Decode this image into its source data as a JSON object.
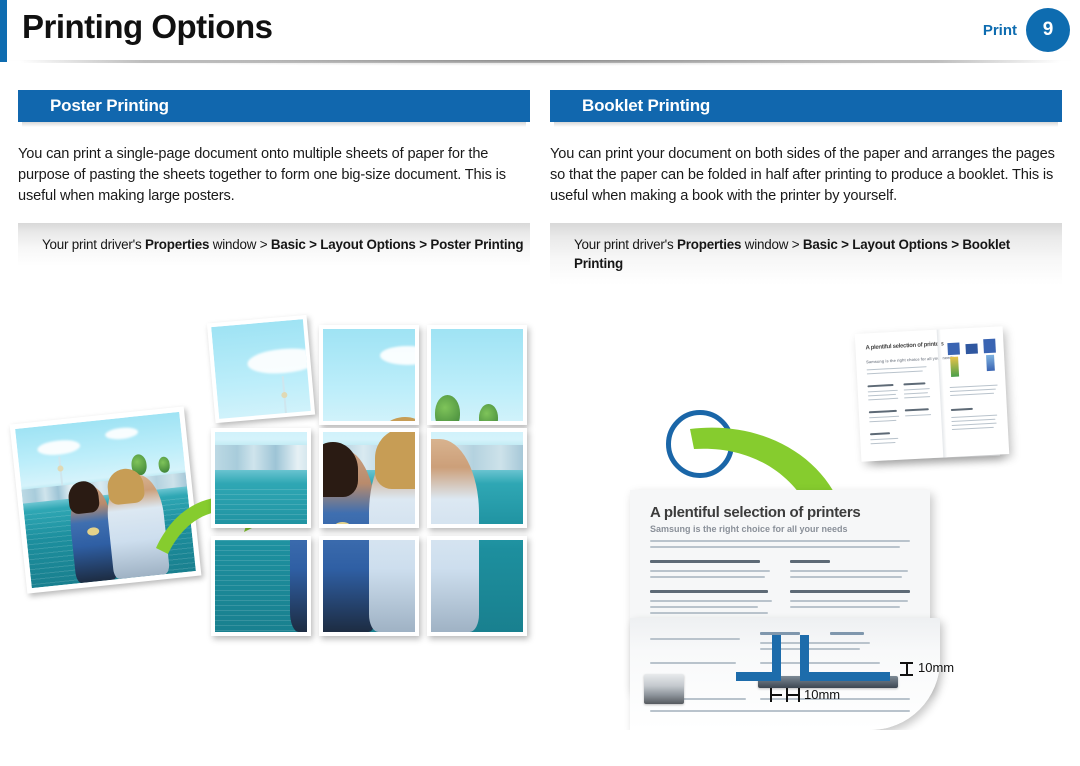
{
  "header": {
    "title": "Printing Options",
    "section_label": "Print",
    "page_number": "9",
    "accent_color": "#0e6cb0"
  },
  "columns": [
    {
      "id": "poster-printing",
      "heading": "Poster Printing",
      "body": "You can print a single-page document onto multiple sheets of paper for the purpose of pasting the sheets together to form one big-size document. This is useful when making large posters.",
      "path": {
        "prefix": "Your print driver's ",
        "bold1": "Properties",
        "mid": " window > ",
        "bold2": "Basic > Layout Options > Poster Printing"
      }
    },
    {
      "id": "booklet-printing",
      "heading": "Booklet Printing",
      "body": "You can print your document on both sides of the paper and arranges the pages so that the paper can be folded in half after printing to produce a booklet. This is useful when making a book with the printer by yourself.",
      "path": {
        "prefix": "Your print driver's ",
        "bold1": "Properties",
        "mid": " window > ",
        "bold2": "Basic > Layout Options > Booklet Printing"
      }
    }
  ],
  "illustrations": {
    "poster": {
      "caption_alt": "Single photo split onto a 3 by 3 grid of printed sheets",
      "grid_rows": 3,
      "grid_cols": 3
    },
    "booklet": {
      "caption_alt": "Document sheet folded into a booklet",
      "doc_heading": "A plentiful selection of printers",
      "doc_subheading": "Samsung is the right choice for all your needs",
      "booklet_heading": "A plentiful selection of printers",
      "booklet_subheading": "Samsung is the right choice for all your needs",
      "measure_fold": "10mm",
      "measure_edge": "10mm",
      "mark_color": "#1d6cab"
    }
  },
  "theme": {
    "header_blue": "#1167ae",
    "arrow_green": "#86cc2e",
    "circle_blue": "#1a66a8"
  }
}
